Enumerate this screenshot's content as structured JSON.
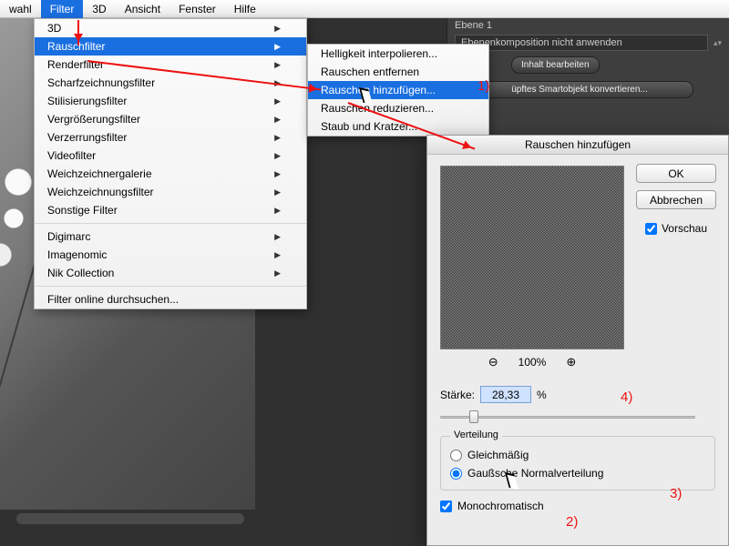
{
  "menubar": {
    "items": [
      "wahl",
      "Filter",
      "3D",
      "Ansicht",
      "Fenster",
      "Hilfe"
    ],
    "activeIndex": 1
  },
  "menu1": {
    "groups": [
      [
        {
          "label": "3D",
          "sub": true
        },
        {
          "label": "Rauschfilter",
          "sub": true,
          "hl": true
        },
        {
          "label": "Renderfilter",
          "sub": true
        },
        {
          "label": "Scharfzeichnungsfilter",
          "sub": true
        },
        {
          "label": "Stilisierungsfilter",
          "sub": true
        },
        {
          "label": "Vergrößerungsfilter",
          "sub": true
        },
        {
          "label": "Verzerrungsfilter",
          "sub": true
        },
        {
          "label": "Videofilter",
          "sub": true
        },
        {
          "label": "Weichzeichnergalerie",
          "sub": true
        },
        {
          "label": "Weichzeichnungsfilter",
          "sub": true
        },
        {
          "label": "Sonstige Filter",
          "sub": true
        }
      ],
      [
        {
          "label": "Digimarc",
          "sub": true
        },
        {
          "label": "Imagenomic",
          "sub": true
        },
        {
          "label": "Nik Collection",
          "sub": true
        }
      ],
      [
        {
          "label": "Filter online durchsuchen..."
        }
      ]
    ]
  },
  "menu2": {
    "items": [
      {
        "label": "Helligkeit interpolieren..."
      },
      {
        "label": "Rauschen entfernen"
      },
      {
        "label": "Rauschen hinzufügen...",
        "hl": true
      },
      {
        "label": "Rauschen reduzieren..."
      },
      {
        "label": "Staub und Kratzer..."
      }
    ]
  },
  "rpanel": {
    "layer": "Ebene 1",
    "combo": "Ebenenkomposition nicht anwenden",
    "btn1": "Inhalt bearbeiten",
    "btn2": "üpftes Smartobjekt konvertieren..."
  },
  "dialog": {
    "title": "Rauschen hinzufügen",
    "ok": "OK",
    "cancel": "Abbrechen",
    "preview": "Vorschau",
    "zoom": "100%",
    "strengthLabel": "Stärke:",
    "strengthValue": "28,33",
    "percent": "%",
    "groupTitle": "Verteilung",
    "radio1": "Gleichmäßig",
    "radio2": "Gaußsche Normalverteilung",
    "mono": "Monochromatisch"
  },
  "ann": {
    "n1": "1)",
    "n2": "2)",
    "n3": "3)",
    "n4": "4)"
  }
}
